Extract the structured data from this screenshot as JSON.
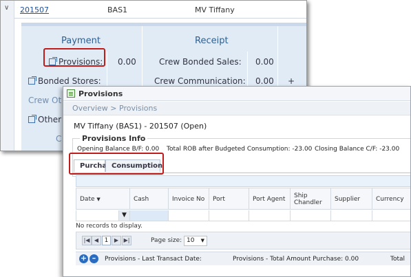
{
  "background": {
    "voyage_id": "201507",
    "vessel_code": "BAS1",
    "vessel_name": "MV Tiffany",
    "payment_header": "Payment",
    "receipt_header": "Receipt",
    "rows": {
      "provisions_label": "Provisions:",
      "provisions_value": "0.00",
      "bonded_label": "Bonded Stores:",
      "crew_other_label": "Crew Ot",
      "other_label": "Other",
      "c_label": "C",
      "crew_bonded_sales_label": "Crew Bonded Sales:",
      "crew_bonded_sales_value": "0.00",
      "crew_comm_label": "Crew Communication:",
      "crew_comm_value": "0.00",
      "plus": "+"
    }
  },
  "popup": {
    "title": "Provisions",
    "breadcrumb": "Overview > Provisions",
    "vessel_line": "MV Tiffany (BAS1) - 201507 (Open)",
    "info_legend": "Provisions Info",
    "opening_balance": "Opening Balance B/F: 0.00",
    "total_rob": "Total ROB after Budgeted Consumption: -23.00",
    "closing_balance": "Closing Balance C/F: -23.00",
    "tabs": [
      "Purchase",
      "Consumption"
    ],
    "columns": [
      "Date",
      "Cash",
      "Invoice No",
      "Port",
      "Port Agent",
      "Ship Chandler",
      "Supplier",
      "Currency"
    ],
    "no_records": "No records to display.",
    "pager": {
      "page": "1",
      "page_size_label": "Page size:",
      "page_size_value": "10"
    },
    "footer": {
      "last_transact": "Provisions - Last Transact Date:",
      "total_purchase": "Provisions - Total Amount Purchase: 0.00",
      "total_trunc": "Total"
    }
  },
  "colors": {
    "highlight": "#c01b1b",
    "link": "#1f4f97",
    "accent": "#2a6cc2"
  }
}
